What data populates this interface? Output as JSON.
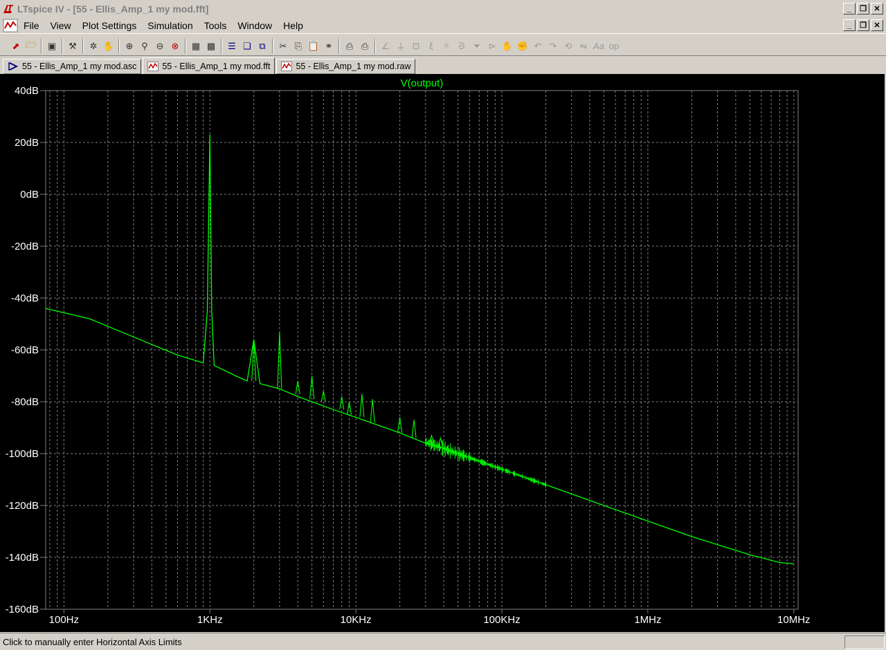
{
  "window": {
    "title": "LTspice IV - [55 - Ellis_Amp_1 my mod.fft]"
  },
  "menu": [
    "File",
    "View",
    "Plot Settings",
    "Simulation",
    "Tools",
    "Window",
    "Help"
  ],
  "tabs": [
    {
      "label": "55 - Ellis_Amp_1 my mod.asc",
      "active": false
    },
    {
      "label": "55 - Ellis_Amp_1 my mod.fft",
      "active": true
    },
    {
      "label": "55 - Ellis_Amp_1 my mod.raw",
      "active": false
    }
  ],
  "status": {
    "text": "Click to manually enter Horizontal Axis Limits"
  },
  "colors": {
    "trace": "#00ff00",
    "grid": "#808080",
    "axis_text": "#ffffff",
    "background": "#000000"
  },
  "chart_data": {
    "type": "line",
    "series": [
      {
        "name": "V(output)",
        "x": [
          75,
          150,
          300,
          600,
          900,
          960,
          1000,
          1030,
          1070,
          1500,
          1800,
          2000,
          2200,
          3000,
          4000,
          5000,
          7000,
          10000,
          20000,
          30000,
          40000,
          50000,
          100000,
          200000,
          500000,
          1000000,
          2000000,
          5000000,
          8000000,
          10000000
        ],
        "y": [
          -44,
          -48,
          -55,
          -62,
          -65,
          -45,
          23,
          -45,
          -66,
          -70,
          -72,
          -56,
          -73,
          -75,
          -78,
          -80,
          -83,
          -86,
          -92,
          -96,
          -98,
          -100,
          -106,
          -112,
          -120,
          -126,
          -132,
          -139,
          -142,
          -142.5
        ]
      }
    ],
    "spikes": [
      {
        "x": 2000,
        "base": -72,
        "peak": -56
      },
      {
        "x": 3000,
        "base": -75,
        "peak": -53
      },
      {
        "x": 4000,
        "base": -77,
        "peak": -72
      },
      {
        "x": 5000,
        "base": -79,
        "peak": -70
      },
      {
        "x": 6000,
        "base": -80,
        "peak": -76
      },
      {
        "x": 8000,
        "base": -83,
        "peak": -78
      },
      {
        "x": 9000,
        "base": -85,
        "peak": -80
      },
      {
        "x": 11000,
        "base": -86,
        "peak": -77
      },
      {
        "x": 13000,
        "base": -88,
        "peak": -79
      },
      {
        "x": 20000,
        "base": -92,
        "peak": -86
      },
      {
        "x": 25000,
        "base": -94,
        "peak": -87
      },
      {
        "x": 33000,
        "base": -96,
        "peak": -93
      },
      {
        "x": 38000,
        "base": -97,
        "peak": -94
      }
    ],
    "xlabel": "",
    "ylabel": "",
    "xscale": "log",
    "xlim": [
      75,
      10700000
    ],
    "ylim": [
      -160,
      40
    ],
    "xticks": [
      {
        "value": 100,
        "label": "100Hz"
      },
      {
        "value": 1000,
        "label": "1KHz"
      },
      {
        "value": 10000,
        "label": "10KHz"
      },
      {
        "value": 100000,
        "label": "100KHz"
      },
      {
        "value": 1000000,
        "label": "1MHz"
      },
      {
        "value": 10000000,
        "label": "10MHz"
      }
    ],
    "yticks": [
      {
        "value": 40,
        "label": "40dB"
      },
      {
        "value": 20,
        "label": "20dB"
      },
      {
        "value": 0,
        "label": "0dB"
      },
      {
        "value": -20,
        "label": "-20dB"
      },
      {
        "value": -40,
        "label": "-40dB"
      },
      {
        "value": -60,
        "label": "-60dB"
      },
      {
        "value": -80,
        "label": "-80dB"
      },
      {
        "value": -100,
        "label": "-100dB"
      },
      {
        "value": -120,
        "label": "-120dB"
      },
      {
        "value": -140,
        "label": "-140dB"
      },
      {
        "value": -160,
        "label": "-160dB"
      }
    ],
    "grid": true,
    "legend": "top-center"
  }
}
